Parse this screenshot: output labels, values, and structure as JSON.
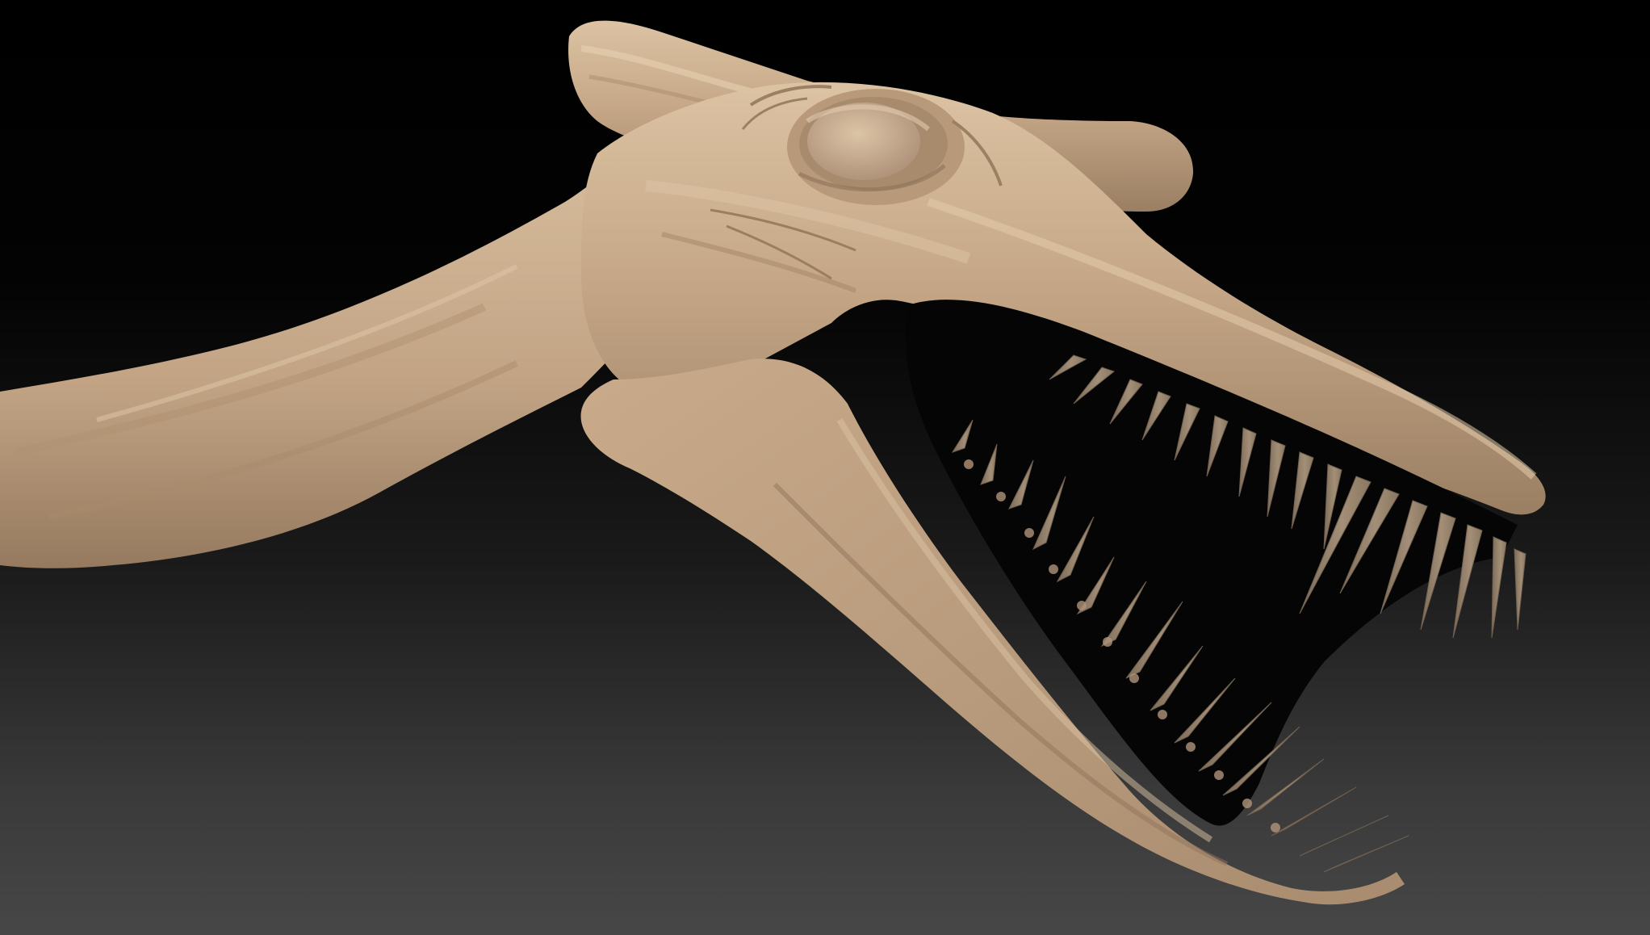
{
  "scene": {
    "subject": "",
    "colors": {
      "background_top": "#000000",
      "background_bottom": "#474747",
      "clay": "#c4a587",
      "clay_light": "#d9bf9f",
      "clay_shadow": "#8a6f55",
      "teeth": "#8f7d68",
      "teeth_light": "#b09c84"
    }
  }
}
